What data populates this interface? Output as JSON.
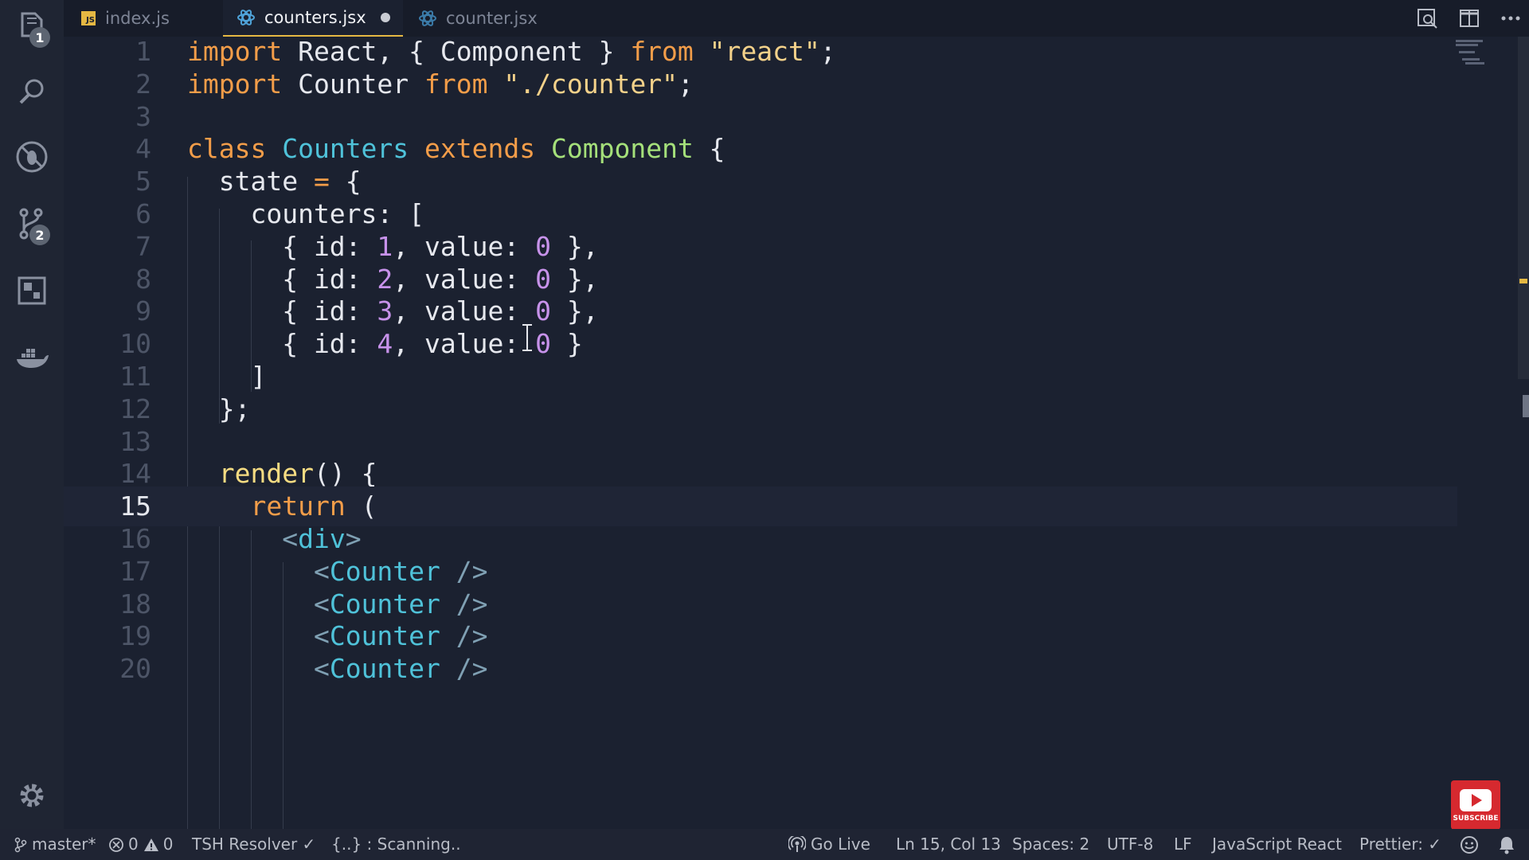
{
  "tabs": [
    {
      "label": "index.js",
      "icon": "js-file-icon",
      "active": false
    },
    {
      "label": "counters.jsx",
      "icon": "react-file-icon",
      "active": true,
      "modified": true
    },
    {
      "label": "counter.jsx",
      "icon": "react-file-icon",
      "active": false
    }
  ],
  "activity": {
    "explorer_badge": "1",
    "scm_badge": "2"
  },
  "js_badge": "JS",
  "code": {
    "current_line": 15,
    "lines": [
      {
        "num": "1",
        "text": "import React, { Component } from \"react\";"
      },
      {
        "num": "2",
        "text": "import Counter from \"./counter\";"
      },
      {
        "num": "3",
        "text": ""
      },
      {
        "num": "4",
        "text": "class Counters extends Component {"
      },
      {
        "num": "5",
        "text": "  state = {"
      },
      {
        "num": "6",
        "text": "    counters: ["
      },
      {
        "num": "7",
        "text": "      { id: 1, value: 0 },"
      },
      {
        "num": "8",
        "text": "      { id: 2, value: 0 },"
      },
      {
        "num": "9",
        "text": "      { id: 3, value: 0 },"
      },
      {
        "num": "10",
        "text": "      { id: 4, value: 0 }"
      },
      {
        "num": "11",
        "text": "    ]"
      },
      {
        "num": "12",
        "text": "  };"
      },
      {
        "num": "13",
        "text": ""
      },
      {
        "num": "14",
        "text": "  render() {"
      },
      {
        "num": "15",
        "text": "    return ("
      },
      {
        "num": "16",
        "text": "      <div>"
      },
      {
        "num": "17",
        "text": "        <Counter />"
      },
      {
        "num": "18",
        "text": "        <Counter />"
      },
      {
        "num": "19",
        "text": "        <Counter />"
      },
      {
        "num": "20",
        "text": "        <Counter />"
      }
    ]
  },
  "status": {
    "branch": "master*",
    "errors": "0",
    "warnings": "0",
    "resolver": "TSH Resolver ✓",
    "scanning": "{..} : Scanning..",
    "golive": "Go Live",
    "position": "Ln 15, Col 13",
    "spaces": "Spaces: 2",
    "encoding": "UTF-8",
    "eol": "LF",
    "language": "JavaScript React",
    "prettier": "Prettier: ✓"
  },
  "youtube": {
    "label": "SUBSCRIBE"
  },
  "colors": {
    "keyword": "#f39d49",
    "string": "#f3d18a",
    "class": "#4fc2d9",
    "number": "#c792ea",
    "accent": "#e5b843"
  }
}
